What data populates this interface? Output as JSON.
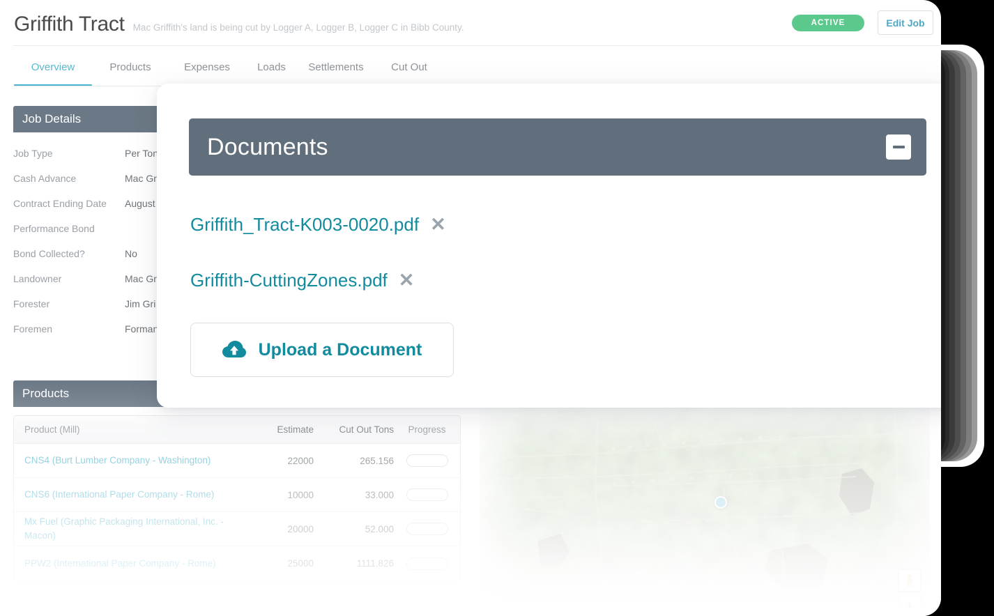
{
  "header": {
    "title": "Griffith Tract",
    "subtitle": "Mac Griffith's land is being cut by Logger A, Logger B, Logger C in Bibb County.",
    "status_badge": "ACTIVE",
    "edit_button": "Edit Job"
  },
  "tabs": [
    {
      "label": "Overview",
      "active": true
    },
    {
      "label": "Products",
      "active": false
    },
    {
      "label": "Expenses",
      "active": false
    },
    {
      "label": "Loads",
      "active": false
    },
    {
      "label": "Settlements",
      "active": false
    },
    {
      "label": "Cut Out",
      "active": false
    }
  ],
  "job_details": {
    "panel_title": "Job Details",
    "rows": [
      {
        "label": "Job Type",
        "value": "Per Ton"
      },
      {
        "label": "Cash Advance",
        "value": "Mac Gr"
      },
      {
        "label": "Contract Ending Date",
        "value": "August"
      },
      {
        "label": "Performance Bond",
        "value": ""
      },
      {
        "label": "Bond Collected?",
        "value": "No"
      },
      {
        "label": "Landowner",
        "value": "Mac Gr"
      },
      {
        "label": "Forester",
        "value": "Jim Gri"
      },
      {
        "label": "Foremen",
        "value": "Forman"
      }
    ]
  },
  "products": {
    "panel_title": "Products",
    "columns": [
      "Product (Mill)",
      "Estimate",
      "Cut Out Tons",
      "Progress"
    ],
    "rows": [
      {
        "product": "CNS4 (Burt Lumber Company - Washington)",
        "estimate": "22000",
        "cut_out_tons": "265.156"
      },
      {
        "product": "CNS6 (International Paper Company - Rome)",
        "estimate": "10000",
        "cut_out_tons": "33.000"
      },
      {
        "product": "Mx Fuel (Graphic Packaging International, Inc. - Macon)",
        "estimate": "20000",
        "cut_out_tons": "52.000"
      },
      {
        "product": "PPW2 (International Paper Company - Rome)",
        "estimate": "25000",
        "cut_out_tons": "1111.826"
      }
    ]
  },
  "documents_modal": {
    "title": "Documents",
    "minimize_label": "–",
    "files": [
      {
        "name": "Griffith_Tract-K003-0020.pdf",
        "remove_label": "✕"
      },
      {
        "name": "Griffith-CuttingZones.pdf",
        "remove_label": "✕"
      }
    ],
    "upload_button_label": "Upload a Document"
  },
  "map": {
    "marker_label": "job-location-marker",
    "pegman_label": "street-view-pegman",
    "zoom_in_label": "+"
  },
  "colors": {
    "accent_teal": "#128b9e",
    "tab_active": "#4bb4cd",
    "status_green": "#5cc98c",
    "panel_header": "#6b7885",
    "modal_header": "#616f7d"
  }
}
